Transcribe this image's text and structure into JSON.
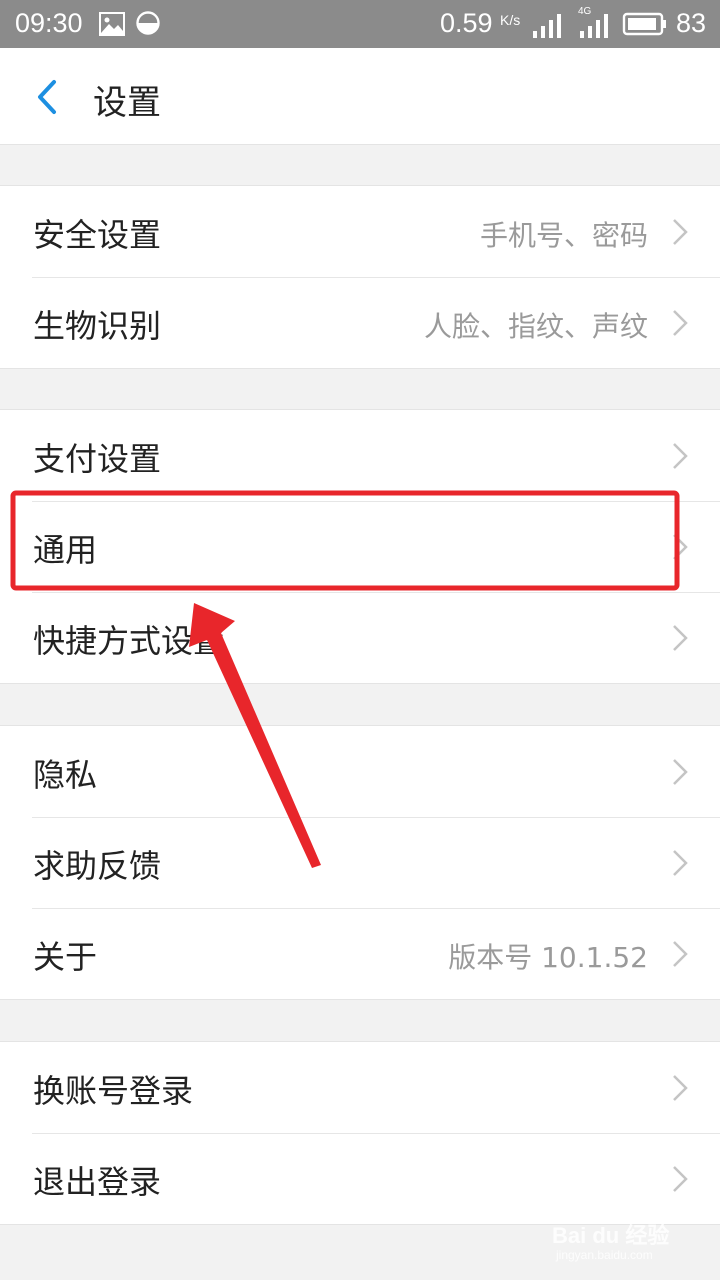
{
  "status_bar": {
    "time": "09:30",
    "speed": "0.59",
    "speed_unit": "K/s",
    "network": "4G",
    "battery": "83",
    "icons": [
      "image-icon",
      "dnd-icon",
      "signal-icon",
      "signal-4g-icon",
      "battery-icon"
    ]
  },
  "header": {
    "title": "设置"
  },
  "groups": [
    {
      "items": [
        {
          "label": "安全设置",
          "value": "手机号、密码"
        },
        {
          "label": "生物识别",
          "value": "人脸、指纹、声纹"
        }
      ]
    },
    {
      "items": [
        {
          "label": "支付设置",
          "value": ""
        },
        {
          "label": "通用",
          "value": ""
        },
        {
          "label": "快捷方式设置",
          "value": ""
        }
      ]
    },
    {
      "items": [
        {
          "label": "隐私",
          "value": ""
        },
        {
          "label": "求助反馈",
          "value": ""
        },
        {
          "label": "关于",
          "value": "版本号 10.1.52"
        }
      ]
    },
    {
      "items": [
        {
          "label": "换账号登录",
          "value": ""
        },
        {
          "label": "退出登录",
          "value": ""
        }
      ]
    }
  ],
  "annotation": {
    "highlight_color": "#e8262b"
  },
  "colors": {
    "accent": "#1d8fe1",
    "status_bar": "#8b8b8b"
  },
  "watermark": {
    "logo": "Bai du 经验",
    "url": "jingyan.baidu.com"
  }
}
